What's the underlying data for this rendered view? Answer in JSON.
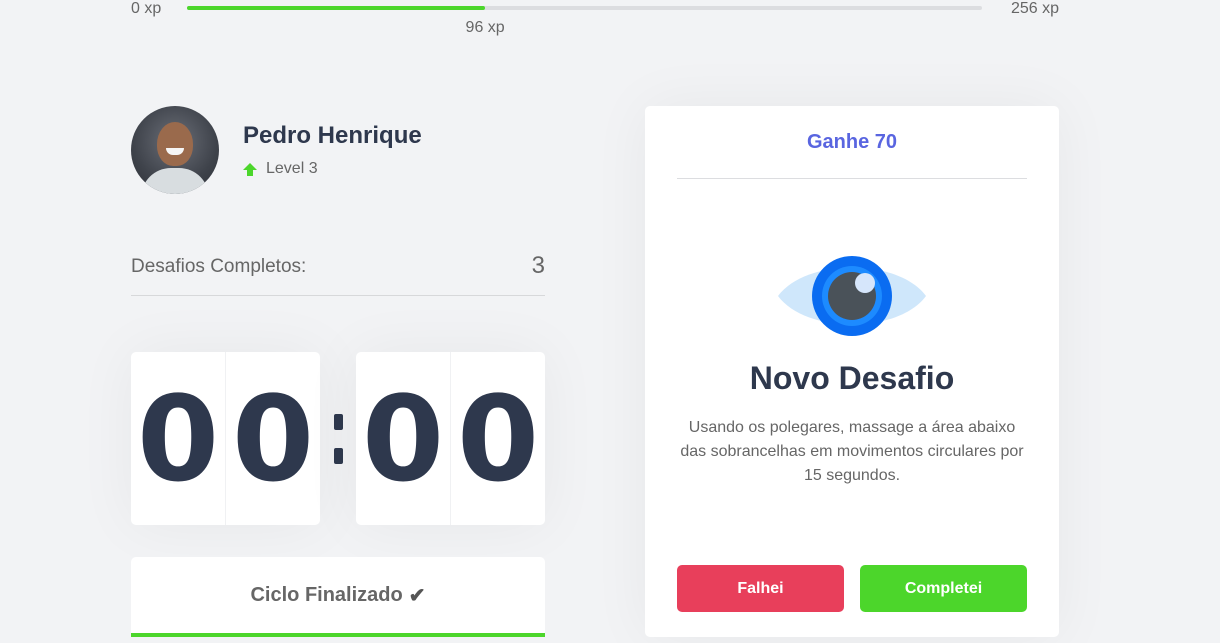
{
  "xp": {
    "min_label": "0 xp",
    "max_label": "256 xp",
    "current_label": "96 xp",
    "progress": 0.375
  },
  "profile": {
    "name": "Pedro Henrique",
    "level": "Level 3"
  },
  "completed": {
    "label": "Desafios Completos:",
    "count": "3"
  },
  "countdown": {
    "minutes": [
      "0",
      "0"
    ],
    "seconds": [
      "0",
      "0"
    ]
  },
  "cycle": {
    "label": "Ciclo Finalizado",
    "icon": "✔"
  },
  "challenge": {
    "header": "Ganhe 70",
    "icon": "eye-icon",
    "title": "Novo Desafio",
    "description": "Usando os polegares, massage a área abaixo das sobrancelhas em movimentos circulares por 15 segundos.",
    "fail_label": "Falhei",
    "success_label": "Completei"
  },
  "colors": {
    "background": "#f2f3f5",
    "green": "#4cd62b",
    "red": "#e83f5b",
    "blue": "#5965e0",
    "title": "#2e384d",
    "text": "#666666"
  }
}
